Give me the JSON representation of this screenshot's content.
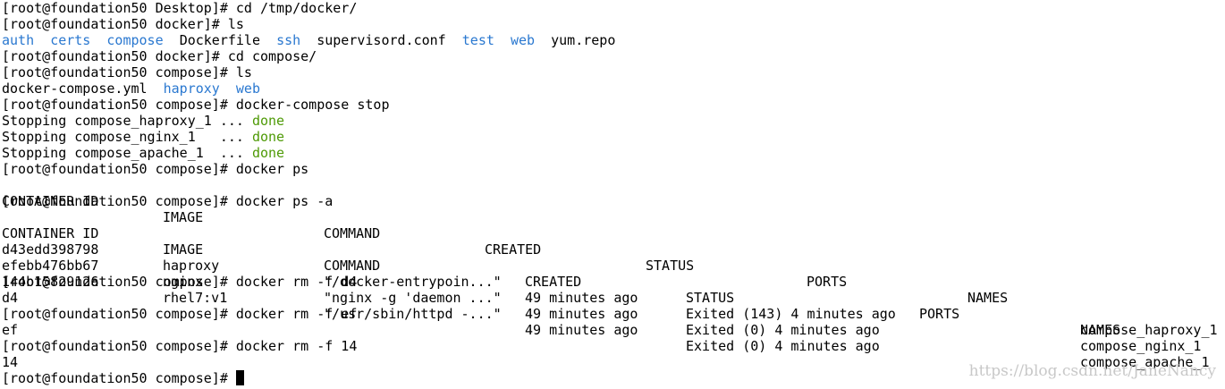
{
  "terminal": {
    "line_01": "[root@foundation50 Desktop]# cd /tmp/docker/",
    "line_02": "[root@foundation50 docker]# ls",
    "ls_docker": {
      "auth": "auth",
      "certs": "certs",
      "compose": "compose",
      "dockerfile": "Dockerfile",
      "ssh": "ssh",
      "supervisord": "supervisord.conf",
      "test": "test",
      "web": "web",
      "yum": "yum.repo"
    },
    "line_04": "[root@foundation50 docker]# cd compose/",
    "line_05": "[root@foundation50 compose]# ls",
    "ls_compose": {
      "yml": "docker-compose.yml",
      "haproxy": "haproxy",
      "web": "web"
    },
    "line_07": "[root@foundation50 compose]# docker-compose stop",
    "stop_haproxy": "Stopping compose_haproxy_1 ... ",
    "stop_nginx": "Stopping compose_nginx_1   ... ",
    "stop_apache": "Stopping compose_apache_1  ... ",
    "done": "done",
    "line_11": "[root@foundation50 compose]# docker ps",
    "ps_header": [
      "CONTAINER ID",
      "IMAGE",
      "COMMAND",
      "CREATED",
      "STATUS",
      "PORTS",
      "NAMES"
    ],
    "line_13": "[root@foundation50 compose]# docker ps -a",
    "psa_header": [
      "CONTAINER ID",
      "IMAGE",
      "COMMAND",
      "CREATED",
      "STATUS",
      "PORTS",
      "NAMES"
    ],
    "psa_rows": [
      [
        "d43edd398798",
        "haproxy",
        "\"/docker-entrypoin...\"",
        "49 minutes ago",
        "Exited (143) 4 minutes ago",
        "",
        "compose_haproxy_1"
      ],
      [
        "efebb476bb67",
        "nginx",
        "\"nginx -g 'daemon ...\"",
        "49 minutes ago",
        "Exited (0) 4 minutes ago",
        "",
        "compose_nginx_1"
      ],
      [
        "144b15829126",
        "rhel7:v1",
        "\"/usr/sbin/httpd -...\"",
        "49 minutes ago",
        "Exited (0) 4 minutes ago",
        "",
        "compose_apache_1"
      ]
    ],
    "line_18": "[root@foundation50 compose]# docker rm -f d4",
    "line_19": "d4",
    "line_20": "[root@foundation50 compose]# docker rm -f ef",
    "line_21": "ef",
    "line_22": "[root@foundation50 compose]# docker rm -f 14",
    "line_23": "14",
    "line_24": "[root@foundation50 compose]# "
  },
  "watermark": "https://blog.csdn.net/JaneNancy",
  "colors": {
    "directory": "#2a78d0",
    "done": "#4e9a06",
    "background": "#ffffff",
    "text": "#000000"
  }
}
